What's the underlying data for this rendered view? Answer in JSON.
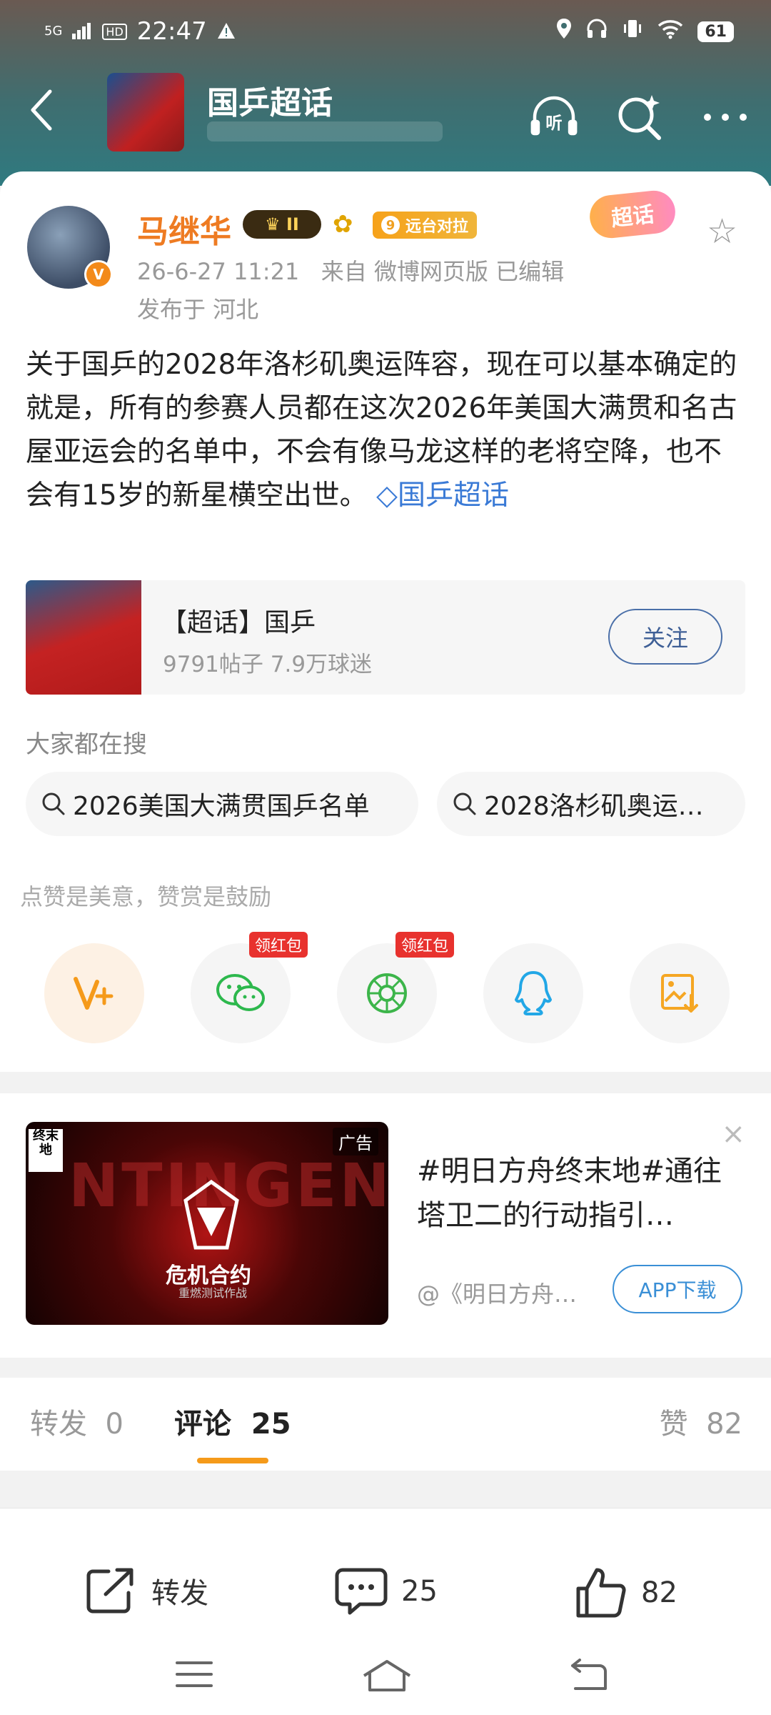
{
  "status_bar": {
    "signal": "5G",
    "hd": "HD",
    "time": "22:47",
    "battery": "61"
  },
  "nav": {
    "back": "‹",
    "title": "国乒超话",
    "listen_label": "听"
  },
  "post": {
    "author": "马继华",
    "level_badge": "II",
    "fan_badge_number": "9",
    "fan_badge_label": "远台对拉",
    "verified": "V",
    "chaohua_tag": "超话",
    "time": "26-6-27  11:21",
    "source": "来自  微博网页版   已编辑",
    "location": "发布于  河北",
    "text": "关于国乒的2028年洛杉矶奥运阵容，现在可以基本确定的就是，所有的参赛人员都在这次2026年美国大满贯和名古屋亚运会的名单中，不会有像马龙这样的老将空降，也不会有15岁的新星横空出世。",
    "topic_link": "国乒超话"
  },
  "chaohua_card": {
    "title": "【超话】国乒",
    "stats": "9791帖子  7.9万球迷",
    "follow_label": "关注"
  },
  "search": {
    "label": "大家都在搜",
    "items": [
      "2026美国大满贯国乒名单",
      "2028洛杉矶奥运…"
    ]
  },
  "reward": {
    "hint": "点赞是美意，赞赏是鼓励",
    "hongbao_label": "领红包",
    "colors": {
      "vplus": "#f59a1a",
      "wechat": "#2db84d",
      "moments": "#3cb54a",
      "qq": "#22a7e6",
      "album": "#f5a623"
    }
  },
  "ad": {
    "tag": "广告",
    "banner_big": "NTINGENCY",
    "banner_game": "危机合约",
    "banner_sub": "重燃测试作战",
    "banner_logo": "终末地",
    "title": "#明日方舟终末地#通往塔卫二的行动指引…",
    "source": "@《明日方舟…",
    "download_label": "APP下载",
    "close": "×"
  },
  "tabs": {
    "repost": "转发",
    "repost_count": "0",
    "comment": "评论",
    "comment_count": "25",
    "like": "赞",
    "like_count": "82"
  },
  "actions": {
    "repost": "转发",
    "comment_count": "25",
    "like_count": "82"
  }
}
